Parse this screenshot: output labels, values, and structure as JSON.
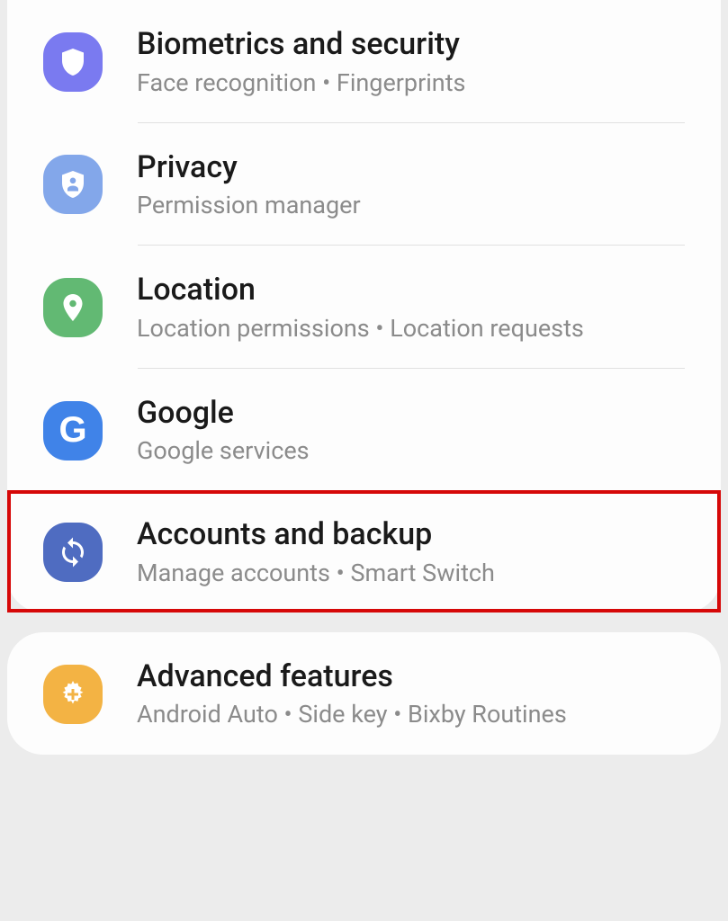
{
  "settings": {
    "group1": [
      {
        "title": "Biometrics and security",
        "subtitle": "Face recognition  •  Fingerprints",
        "icon": "shield",
        "color": "#7a7af0"
      },
      {
        "title": "Privacy",
        "subtitle": "Permission manager",
        "icon": "privacy",
        "color": "#83a7ea"
      },
      {
        "title": "Location",
        "subtitle": "Location permissions  •  Location requests",
        "icon": "location",
        "color": "#62b973"
      },
      {
        "title": "Google",
        "subtitle": "Google services",
        "icon": "google",
        "color": "#4083e8"
      },
      {
        "title": "Accounts and backup",
        "subtitle": "Manage accounts  •  Smart Switch",
        "icon": "sync",
        "color": "#4f6cc1",
        "highlight": true
      }
    ],
    "group2": [
      {
        "title": "Advanced features",
        "subtitle": "Android Auto  •  Side key  •  Bixby Routines",
        "icon": "plus-gear",
        "color": "#f3b344"
      }
    ]
  }
}
